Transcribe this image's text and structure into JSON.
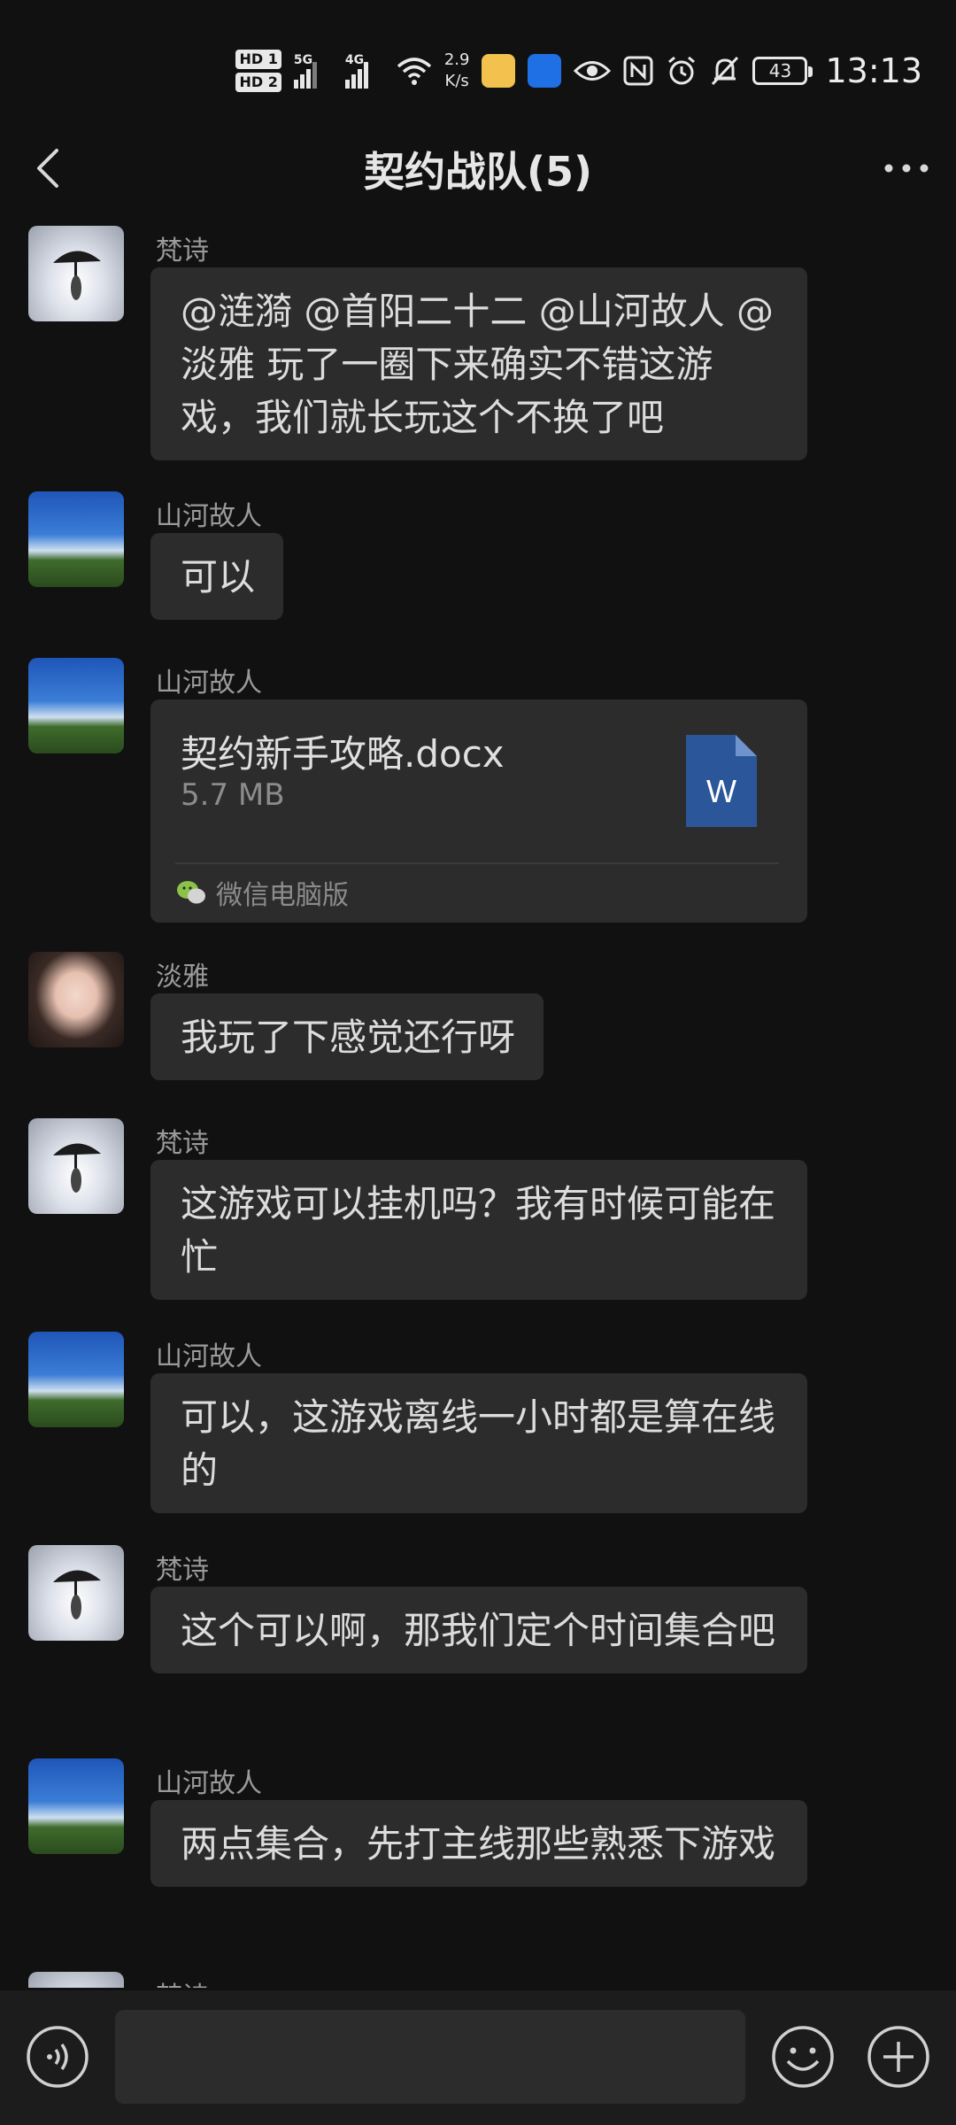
{
  "status_bar": {
    "hd1": "HD 1",
    "hd2": "HD 2",
    "signal1": "5G",
    "signal2": "4G",
    "speed_value": "2.9",
    "speed_unit": "K/s",
    "battery": "43",
    "time": "13:13"
  },
  "header": {
    "title": "契约战队(5)"
  },
  "messages": [
    {
      "sender": "梵诗",
      "text": "@涟漪 @首阳二十二 @山河故人 @淡雅  玩了一圈下来确实不错这游戏，我们就长玩这个不换了吧"
    },
    {
      "sender": "山河故人",
      "text": "可以"
    },
    {
      "sender": "山河故人",
      "file": {
        "name": "契约新手攻略.docx",
        "size": "5.7 MB",
        "source": "微信电脑版",
        "badge": "W"
      }
    },
    {
      "sender": "淡雅",
      "text": "我玩了下感觉还行呀"
    },
    {
      "sender": "梵诗",
      "text": "这游戏可以挂机吗？我有时候可能在忙"
    },
    {
      "sender": "山河故人",
      "text": "可以，这游戏离线一小时都是算在线的"
    },
    {
      "sender": "梵诗",
      "text": "这个可以啊，那我们定个时间集合吧"
    },
    {
      "sender": "山河故人",
      "text": "两点集合，先打主线那些熟悉下游戏"
    },
    {
      "sender": "梵诗"
    }
  ],
  "input": {
    "value": "",
    "placeholder": ""
  },
  "icons": {
    "back": "back-arrow-icon",
    "more": "more-icon",
    "voice": "voice-icon",
    "emoji": "emoji-icon",
    "plus": "plus-icon",
    "file": "word-document-icon",
    "wechat": "wechat-icon"
  },
  "colors": {
    "background": "#111111",
    "bubble": "#2c2c2c",
    "word_blue": "#2b579a",
    "wechat_green": "#8bc34a"
  }
}
